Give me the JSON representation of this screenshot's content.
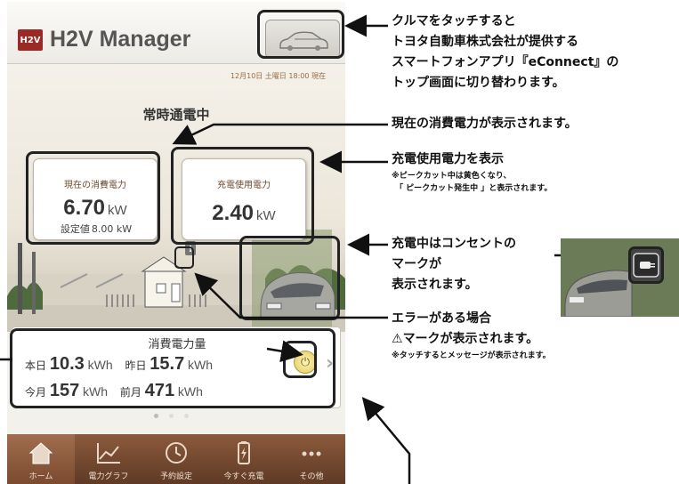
{
  "app": {
    "logo_text": "H2V",
    "title": "H2V Manager",
    "datetime": "12月10日 土曜日 18:00 現在",
    "status": "常時通電中"
  },
  "card_power": {
    "title": "現在の消費電力",
    "value": "6.70",
    "unit": "kW",
    "setting_label": "設定値",
    "setting_value": "8.00 kW"
  },
  "card_charge": {
    "title": "充電使用電力",
    "value": "2.40",
    "unit": "kW"
  },
  "summary": {
    "title": "消費電力量",
    "today_label": "本日",
    "today_value": "10.3",
    "today_unit": "kWh",
    "yesterday_label": "昨日",
    "yesterday_value": "15.7",
    "yesterday_unit": "kWh",
    "month_label": "今月",
    "month_value": "157",
    "month_unit": "kWh",
    "prev_month_label": "前月",
    "prev_month_value": "471",
    "prev_month_unit": "kWh"
  },
  "nav": {
    "items": [
      {
        "label": "ホーム",
        "icon": "home-icon"
      },
      {
        "label": "電力グラフ",
        "icon": "graph-icon"
      },
      {
        "label": "予約設定",
        "icon": "clock-icon"
      },
      {
        "label": "今すぐ充電",
        "icon": "battery-icon"
      },
      {
        "label": "その他",
        "icon": "more-icon"
      }
    ]
  },
  "annotations": {
    "car_1": "クルマをタッチすると",
    "car_2": "トヨタ自動車株式会社が提供する",
    "car_3": "スマートフォンアプリ『eConnect』の",
    "car_4": "トップ画面に切り替わります。",
    "power": "現在の消費電力が表示されます。",
    "charge_title": "充電使用電力を表示",
    "charge_note_1": "※ピークカット中は黄色くなり、",
    "charge_note_2": "「 ピークカット発生中 」と表示されます。",
    "plug_1": "充電中はコンセントの",
    "plug_2": "マークが",
    "plug_3": "表示されます。",
    "error_1": "エラーがある場合",
    "error_2": "マークが表示されます。",
    "error_note": "※タッチするとメッセージが表示されます。"
  },
  "colors": {
    "brand": "#9b2a27",
    "nav_bg": "#6e4630",
    "label_brown": "#6b4a2c"
  }
}
